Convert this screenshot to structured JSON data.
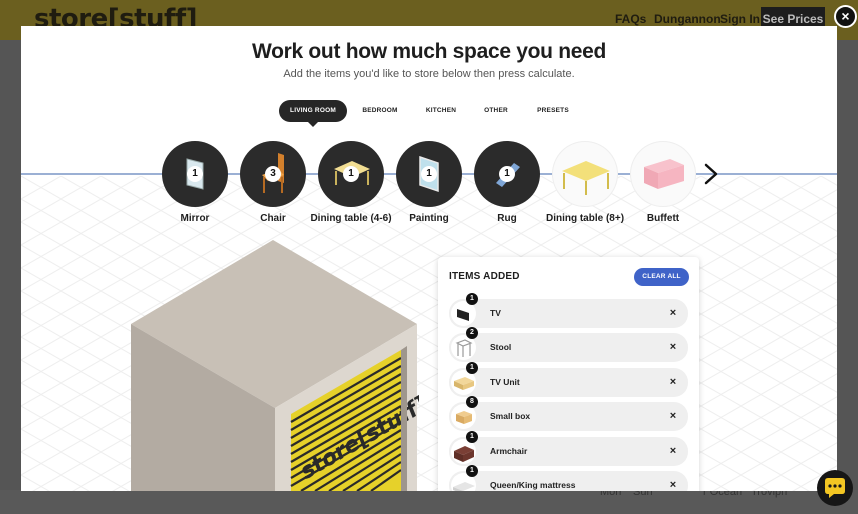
{
  "site": {
    "logo": "store[stuff]",
    "nav": [
      "FAQs",
      "Dungannon",
      "Sign In"
    ],
    "cta": "See Prices",
    "footer_links": [
      "Mon",
      "Sun",
      "r Ocean",
      "Trovipn"
    ]
  },
  "modal": {
    "title": "Work out how much space you need",
    "subtitle": "Add the items you'd like to store below then press calculate.",
    "close_icon": "×",
    "tabs": [
      {
        "label": "LIVING ROOM",
        "active": true
      },
      {
        "label": "BEDROOM",
        "active": false
      },
      {
        "label": "KITCHEN",
        "active": false
      },
      {
        "label": "OTHER",
        "active": false
      },
      {
        "label": "PRESETS",
        "active": false
      }
    ],
    "carousel": [
      {
        "label": "Mirror",
        "count": "1",
        "icon": "mirror-icon"
      },
      {
        "label": "Chair",
        "count": "3",
        "icon": "chair-icon"
      },
      {
        "label": "Dining table (4-6)",
        "count": "1",
        "icon": "dining-table-icon"
      },
      {
        "label": "Painting",
        "count": "1",
        "icon": "painting-icon"
      },
      {
        "label": "Rug",
        "count": "1",
        "icon": "rug-icon"
      },
      {
        "label": "Dining table (8+)",
        "count": "",
        "icon": "large-dining-table-icon"
      },
      {
        "label": "Buffett",
        "count": "",
        "icon": "buffet-icon"
      }
    ],
    "unit_door_text": "store[stuff]",
    "panel": {
      "title": "ITEMS ADDED",
      "clear_label": "CLEAR ALL",
      "remove_icon": "×",
      "items": [
        {
          "label": "TV",
          "count": "1",
          "icon": "tv-icon"
        },
        {
          "label": "Stool",
          "count": "2",
          "icon": "stool-icon"
        },
        {
          "label": "TV Unit",
          "count": "1",
          "icon": "tv-unit-icon"
        },
        {
          "label": "Small box",
          "count": "8",
          "icon": "box-icon"
        },
        {
          "label": "Armchair",
          "count": "1",
          "icon": "armchair-icon"
        },
        {
          "label": "Queen/King mattress",
          "count": "1",
          "icon": "mattress-icon"
        }
      ]
    }
  },
  "colors": {
    "accent": "#3f63c8",
    "dark": "#262626",
    "door_yellow": "#e9d52b",
    "header_overlay": "#6b5f1f"
  }
}
